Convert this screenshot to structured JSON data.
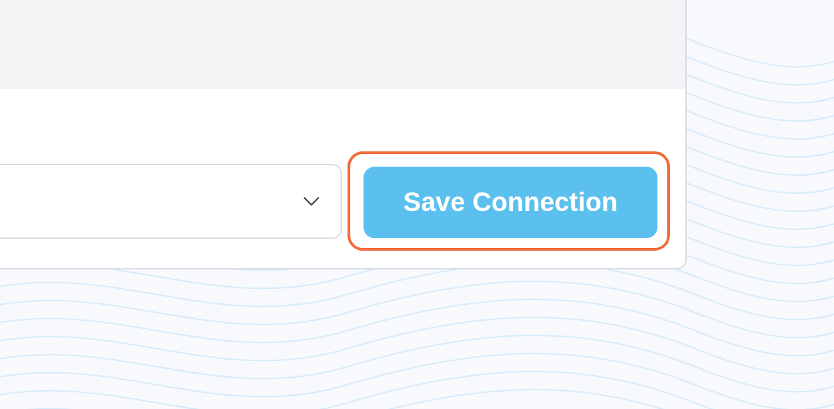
{
  "connection_form": {
    "dropdown": {
      "expanded": false
    },
    "save_button": {
      "label": "Save Connection",
      "highlighted": true
    }
  }
}
